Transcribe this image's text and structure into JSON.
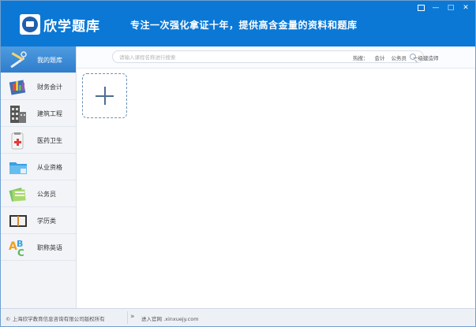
{
  "header": {
    "brand": "欣学题库",
    "slogan": "专注一次强化拿证十年，提供高含金量的资料和题库",
    "logo_icon": "book-seal-logo"
  },
  "window_controls": {
    "restore": "▣",
    "minimize": "—",
    "maximize": "□",
    "close": "✕"
  },
  "search": {
    "placeholder": "请输入课程名称进行搜索",
    "value": ""
  },
  "hot": {
    "label": "热搜：",
    "items": [
      "会计",
      "公务员",
      "一级建造师"
    ]
  },
  "sidebar": {
    "items": [
      {
        "label": "我的题库",
        "icon": "wrench-pencil-icon",
        "active": true
      },
      {
        "label": "财务会计",
        "icon": "ledger-chart-icon",
        "active": false
      },
      {
        "label": "建筑工程",
        "icon": "building-icon",
        "active": false
      },
      {
        "label": "医药卫生",
        "icon": "medical-kit-icon",
        "active": false
      },
      {
        "label": "从业资格",
        "icon": "folder-icon",
        "active": false
      },
      {
        "label": "公务员",
        "icon": "documents-icon",
        "active": false
      },
      {
        "label": "学历类",
        "icon": "open-book-icon",
        "active": false
      },
      {
        "label": "职称英语",
        "icon": "abc-letters-icon",
        "active": false
      }
    ]
  },
  "content": {
    "add_tile_icon": "plus-icon"
  },
  "footer": {
    "copyright": "© 上海欣学教育信息咨询有限公司版权所有",
    "chevron": "»",
    "site": "进入官网 .xinxuejy.com"
  },
  "colors": {
    "header_bg": "#0b78d6",
    "active_item": "#3a8ad6"
  }
}
